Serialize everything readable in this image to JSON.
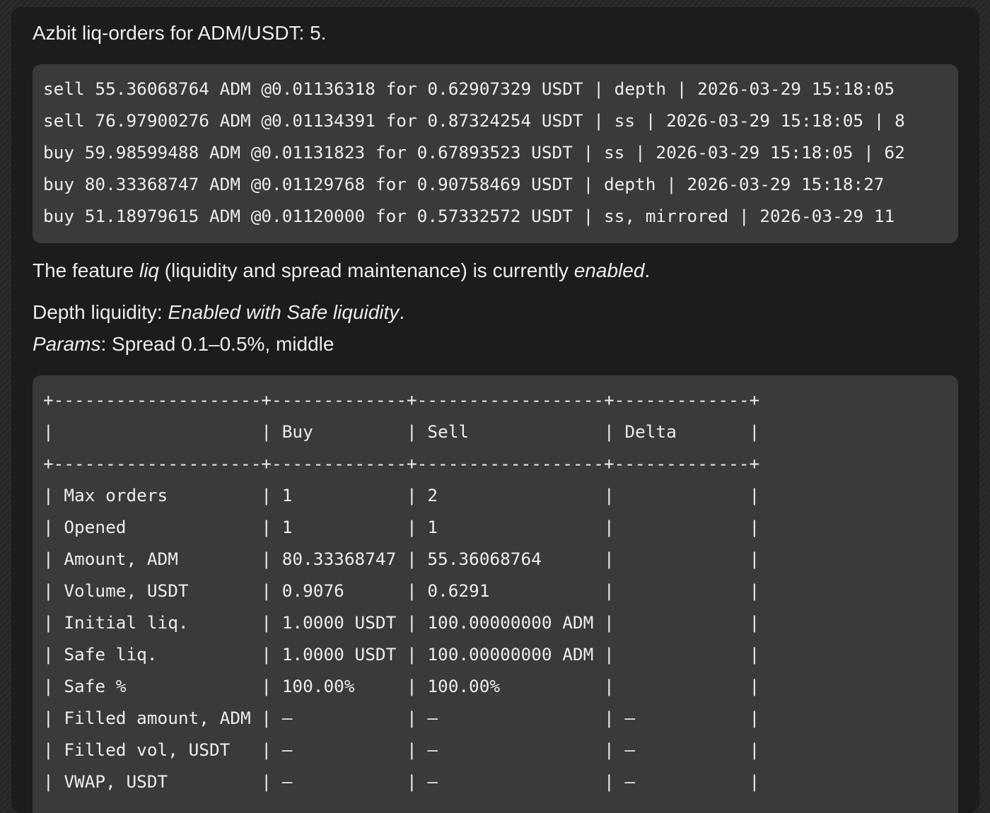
{
  "message": {
    "summary": "Azbit liq-orders for ADM/USDT: 5.",
    "orders": [
      "sell 55.36068764 ADM @0.01136318 for 0.62907329 USDT | depth | 2026-03-29 15:18:05",
      "sell 76.97900276 ADM @0.01134391 for 0.87324254 USDT | ss | 2026-03-29 15:18:05 | 8",
      "buy 59.98599488 ADM @0.01131823 for 0.67893523 USDT | ss | 2026-03-29 15:18:05 | 62",
      "buy 80.33368747 ADM @0.01129768 for 0.90758469 USDT | depth | 2026-03-29 15:18:27",
      "buy 51.18979615 ADM @0.01120000 for 0.57332572 USDT | ss, mirrored | 2026-03-29 11"
    ],
    "feature": {
      "prefix": "The feature ",
      "name": "liq",
      "middle": " (liquidity and spread maintenance) is currently ",
      "state": "enabled",
      "suffix": "."
    },
    "depth": {
      "label": "Depth liquidity",
      "sep": ": ",
      "value": "Enabled with Safe liquidity",
      "suffix": "."
    },
    "params": {
      "label": "Params",
      "sep": ": ",
      "value": "Spread 0.1–0.5%, middle"
    },
    "table_lines": [
      "+--------------------+-------------+------------------+-------------+",
      "|                    | Buy         | Sell             | Delta       |",
      "+--------------------+-------------+------------------+-------------+",
      "| Max orders         | 1           | 2                |             |",
      "| Opened             | 1           | 1                |             |",
      "| Amount, ADM        | 80.33368747 | 55.36068764      |             |",
      "| Volume, USDT       | 0.9076      | 0.6291           |             |",
      "| Initial liq.       | 1.0000 USDT | 100.00000000 ADM |             |",
      "| Safe liq.          | 1.0000 USDT | 100.00000000 ADM |             |",
      "| Safe %             | 100.00%     | 100.00%          |             |",
      "| Filled amount, ADM | –           | –                | –           |",
      "| Filled vol, USDT   | –           | –                | –           |",
      "| VWAP, USDT         | –           | –                | –           |"
    ]
  }
}
